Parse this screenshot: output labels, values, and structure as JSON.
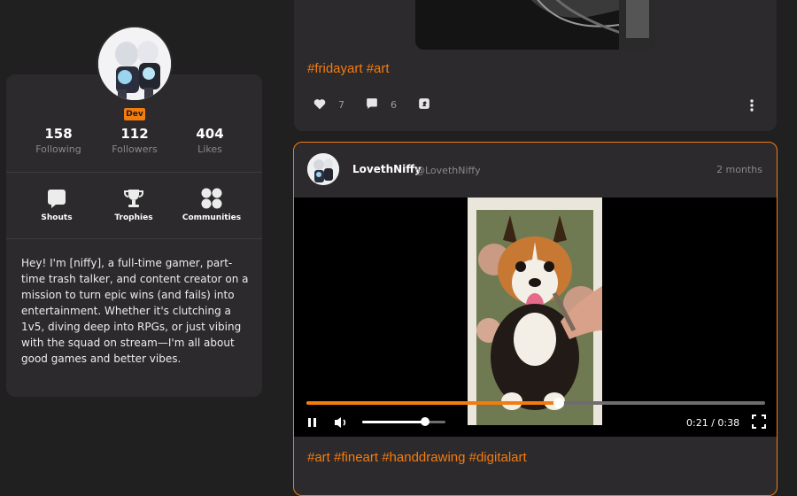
{
  "profile": {
    "badge": "Dev",
    "stats": [
      {
        "value": "158",
        "label": "Following"
      },
      {
        "value": "112",
        "label": "Followers"
      },
      {
        "value": "404",
        "label": "Likes"
      }
    ],
    "menu": [
      {
        "label": "Shouts",
        "icon": "shout-icon"
      },
      {
        "label": "Trophies",
        "icon": "trophy-icon"
      },
      {
        "label": "Communities",
        "icon": "communities-icon"
      }
    ],
    "bio": "Hey! I'm [niffy], a full-time gamer, part-time trash talker, and content creator on a mission to turn epic wins (and fails) into entertainment. Whether it's clutching a 1v5, diving deep into RPGs, or just vibing with the squad on stream—I'm all about good games and better vibes."
  },
  "post_top": {
    "tags": "#fridayart #art",
    "likes": "7",
    "comments": "6"
  },
  "post_main": {
    "author": "LovethNiffy",
    "handle": "@LovethNiffy",
    "time_ago": "2 months",
    "video": {
      "progress": 0.55,
      "volume": 0.75,
      "time": "0:21 / 0:38"
    },
    "tags": "#art #fineart #handdrawing #digitalart"
  },
  "colors": {
    "accent": "#f47c0f",
    "background": "#212021",
    "card": "#2c2a2c"
  }
}
